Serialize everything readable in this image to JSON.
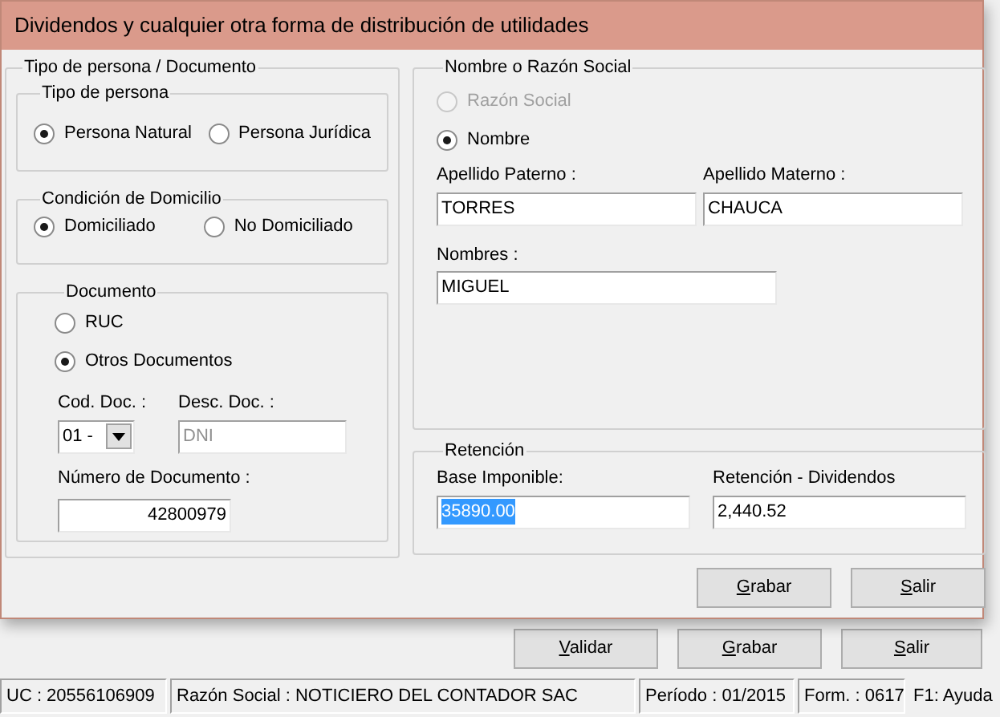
{
  "dialog": {
    "title": "Dividendos y cualquier otra forma de distribución de utilidades",
    "person_group": {
      "legend": "Tipo de persona / Documento",
      "tipo_persona": {
        "legend": "Tipo de persona",
        "options": [
          {
            "label": "Persona Natural",
            "selected": true
          },
          {
            "label": "Persona Jurídica",
            "selected": false
          }
        ]
      },
      "domicilio": {
        "legend": "Condición de Domicilio",
        "options": [
          {
            "label": "Domiciliado",
            "selected": true
          },
          {
            "label": "No Domiciliado",
            "selected": false
          }
        ]
      },
      "documento": {
        "legend": "Documento",
        "options": [
          {
            "label": "RUC",
            "selected": false
          },
          {
            "label": "Otros Documentos",
            "selected": true
          }
        ],
        "cod_doc": {
          "label": "Cod. Doc. :",
          "value": "01 -"
        },
        "desc_doc": {
          "label": "Desc. Doc. :",
          "value": "DNI",
          "disabled": true
        },
        "numero": {
          "label": "Número de Documento :",
          "value": "42800979"
        }
      }
    },
    "name_group": {
      "legend": "Nombre o Razón Social",
      "options": [
        {
          "label": "Razón Social",
          "selected": false,
          "disabled": true
        },
        {
          "label": "Nombre",
          "selected": true,
          "disabled": false
        }
      ],
      "fields": [
        {
          "label": "Apellido Paterno :",
          "value": "TORRES"
        },
        {
          "label": "Apellido Materno :",
          "value": "CHAUCA"
        },
        {
          "label": "Nombres :",
          "value": "MIGUEL"
        }
      ]
    },
    "retencion": {
      "legend": "Retención",
      "fields": [
        {
          "label": "Base Imponible:",
          "value": "35890.00",
          "text_selected": true
        },
        {
          "label": "Retención - Dividendos",
          "value": "2,440.52",
          "text_selected": false
        }
      ]
    },
    "buttons": [
      {
        "label": "Grabar",
        "underline_first": true
      },
      {
        "label": "Salir",
        "underline_first": true
      }
    ]
  },
  "main_buttons": [
    {
      "label": "Validar",
      "underline_first": true
    },
    {
      "label": "Grabar",
      "underline_first": true
    },
    {
      "label": "Salir",
      "underline_first": true
    }
  ],
  "status_bar": [
    "UC : 20556106909",
    "Razón Social : NOTICIERO DEL CONTADOR SAC",
    "Período : 01/2015",
    "Form. : 0617",
    "F1: Ayuda"
  ]
}
